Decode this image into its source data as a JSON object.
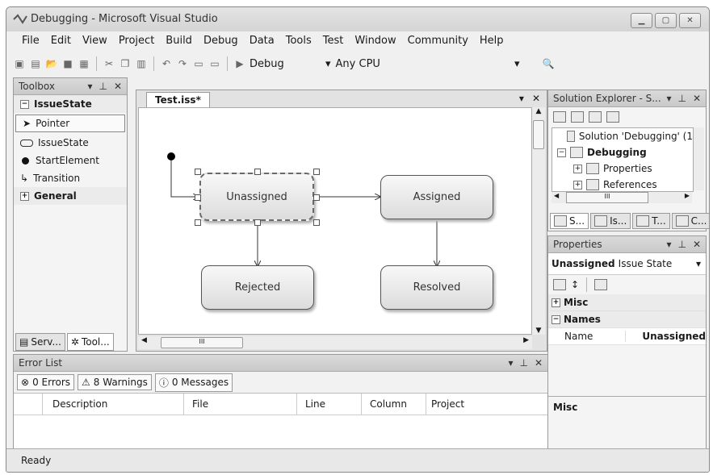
{
  "window": {
    "title": "Debugging - Microsoft Visual Studio"
  },
  "menu": [
    "File",
    "Edit",
    "View",
    "Project",
    "Build",
    "Debug",
    "Data",
    "Tools",
    "Test",
    "Window",
    "Community",
    "Help"
  ],
  "toolbar": {
    "config": "Debug",
    "platform": "Any CPU"
  },
  "toolbox": {
    "title": "Toolbox",
    "group1": "IssueState",
    "items": [
      "Pointer",
      "IssueState",
      "StartElement",
      "Transition"
    ],
    "group2": "General",
    "tab1": "Serv...",
    "tab2": "Tool..."
  },
  "editor": {
    "tab": "Test.iss*",
    "states": {
      "unassigned": "Unassigned",
      "assigned": "Assigned",
      "rejected": "Rejected",
      "resolved": "Resolved"
    },
    "hscroll_thumb": "III"
  },
  "errors": {
    "title": "Error List",
    "errors_btn": "0 Errors",
    "warnings_btn": "8 Warnings",
    "messages_btn": "0 Messages",
    "columns": [
      "Description",
      "File",
      "Line",
      "Column",
      "Project"
    ]
  },
  "solution": {
    "title": "Solution Explorer - S...",
    "solution_node": "Solution 'Debugging' (1",
    "project": "Debugging",
    "properties": "Properties",
    "references": "References",
    "hscroll_thumb": "III",
    "tabs": [
      "S...",
      "Is...",
      "T...",
      "C..."
    ]
  },
  "properties": {
    "title": "Properties",
    "object_name": "Unassigned",
    "object_type": "Issue State",
    "cat_misc": "Misc",
    "cat_names": "Names",
    "prop_name_label": "Name",
    "prop_name_value": "Unassigned",
    "desc_title": "Misc"
  },
  "status": {
    "text": "Ready"
  }
}
